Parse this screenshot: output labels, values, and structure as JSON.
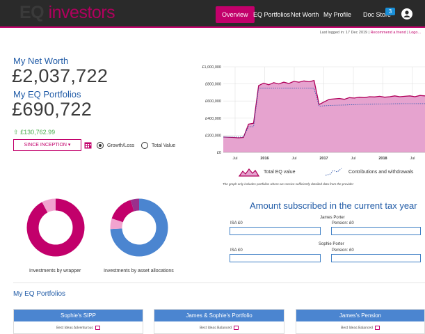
{
  "brand": {
    "logo_eq": "EQ",
    "logo_rest": "investors"
  },
  "nav": {
    "items": [
      "Overview",
      "EQ Portfolios",
      "Net Worth",
      "My Profile",
      "Doc Store"
    ],
    "doc_badge": "3"
  },
  "header": {
    "last_logged": "Last logged in: 17 Dec 2019 | ",
    "recommend": "Recommend a friend",
    "sep": " | ",
    "logout": "Logo..."
  },
  "summary": {
    "net_worth_label": "My Net Worth",
    "net_worth_value": "£2,037,722",
    "portfolios_label": "My EQ Portfolios",
    "portfolios_value": "£690,722",
    "gain": "£130,762.99",
    "since_button": "SINCE INCEPTION ▾",
    "radio_growth": "Growth/Loss",
    "radio_total": "Total Value",
    "selected": "Growth/Loss"
  },
  "chart_data": {
    "type": "area",
    "y_tick_labels": [
      "£1,000,000",
      "£800,000",
      "£600,000",
      "£400,000",
      "£200,000",
      "£0"
    ],
    "x_tick_labels": [
      "Jul",
      "2016",
      "Jul",
      "2017",
      "Jul",
      "2018",
      "Jul"
    ],
    "ylim": [
      0,
      1000000
    ],
    "x": [
      0,
      2,
      3,
      4,
      5,
      6,
      7,
      8,
      9,
      10,
      11,
      12,
      13,
      14,
      15,
      16,
      17,
      18,
      19,
      20,
      21,
      22,
      23,
      24,
      25,
      26,
      27,
      28,
      29,
      30,
      31,
      32,
      33,
      34,
      35,
      36,
      37,
      38,
      39,
      40
    ],
    "series": [
      {
        "name": "Total EQ value",
        "values": [
          180000,
          175000,
          170000,
          175000,
          330000,
          340000,
          780000,
          810000,
          790000,
          815000,
          800000,
          820000,
          805000,
          830000,
          820000,
          835000,
          825000,
          840000,
          560000,
          590000,
          620000,
          625000,
          630000,
          620000,
          640000,
          635000,
          645000,
          640000,
          650000,
          648000,
          655000,
          645000,
          650000,
          660000,
          650000,
          655000,
          660000,
          650000,
          665000,
          660000
        ]
      },
      {
        "name": "Contributions and withdrawals",
        "values": [
          180000,
          180000,
          180000,
          180000,
          300000,
          300000,
          750000,
          750000,
          750000,
          750000,
          750000,
          750000,
          750000,
          750000,
          750000,
          750000,
          750000,
          750000,
          540000,
          545000,
          548000,
          550000,
          552000,
          554000,
          556000,
          558000,
          560000,
          562000,
          563000,
          564000,
          565000,
          566000,
          567000,
          568000,
          569000,
          570000,
          570000,
          570000,
          570000,
          570000
        ]
      }
    ],
    "note": "The graph only includes portfolios where we receive sufficiently detailed data from the provider",
    "colors": {
      "fill": "#e6a3cf",
      "line": "#b0005a",
      "contrib": "#3a5fb0",
      "grid": "#e0e0e0"
    }
  },
  "donuts": [
    {
      "label": "Investments by wrapper",
      "slices": [
        0.92,
        0.08
      ],
      "colors": [
        "#c2006b",
        "#f1a3cf"
      ]
    },
    {
      "label": "Investments by asset allocations",
      "slices": [
        0.74,
        0.06,
        0.15,
        0.05
      ],
      "colors": [
        "#4b85d0",
        "#f1a3cf",
        "#c2006b",
        "#9a2f8c"
      ]
    }
  ],
  "subscribed": {
    "title": "Amount subscribed in the current tax year",
    "people": [
      {
        "name": "James Porter",
        "isa": "ISA £0",
        "pension": "Pension: £0"
      },
      {
        "name": "Sophie Porter",
        "isa": "ISA £0",
        "pension": "Pension: £0"
      }
    ]
  },
  "portfolios": {
    "title": "My EQ Portfolios",
    "cards": [
      {
        "name": "Sophie's SIPP",
        "strategy": "Best Ideas Adventurous"
      },
      {
        "name": "James & Sophie's Portfolio",
        "strategy": "Best Ideas Balanced"
      },
      {
        "name": "James's Pension",
        "strategy": "Best Ideas Balanced"
      }
    ]
  },
  "icons": {
    "calendar": "calendar-icon",
    "user": "user-icon",
    "external": "external-link-icon"
  }
}
